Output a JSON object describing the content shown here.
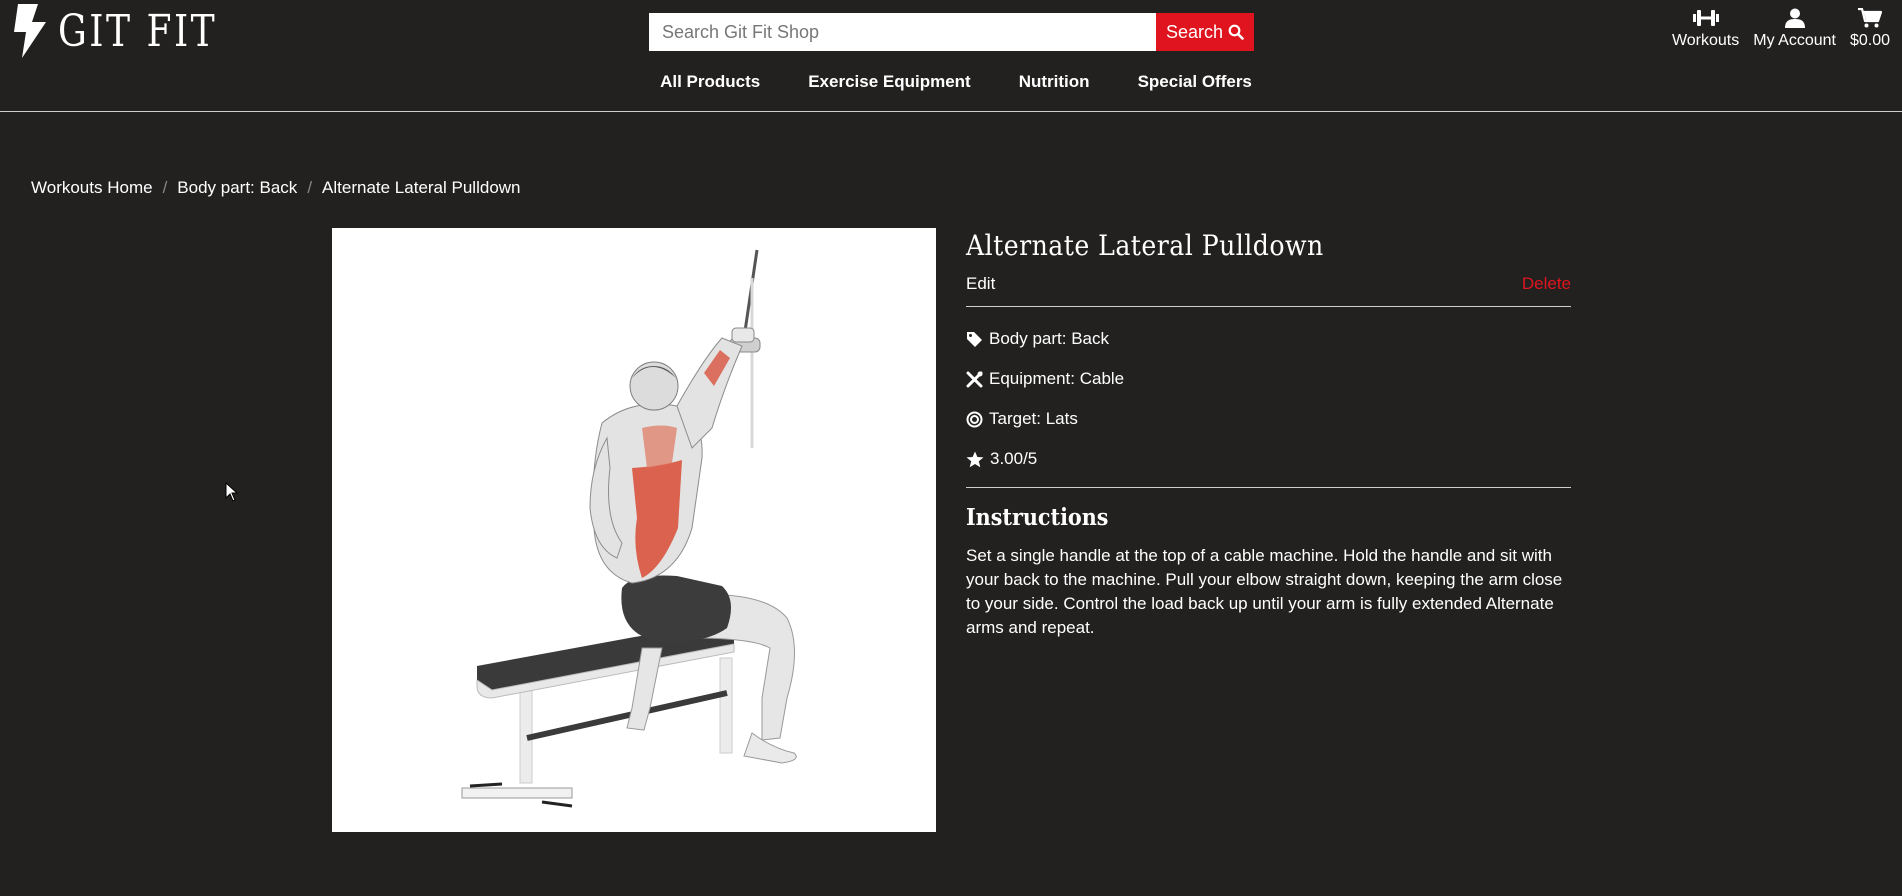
{
  "brand": {
    "name": "GIT FIT"
  },
  "search": {
    "placeholder": "Search Git Fit Shop",
    "button_label": "Search"
  },
  "account_nav": {
    "workouts_label": "Workouts",
    "account_label": "My Account",
    "cart_total": "$0.00"
  },
  "main_nav": {
    "items": [
      {
        "label": "All Products"
      },
      {
        "label": "Exercise Equipment"
      },
      {
        "label": "Nutrition"
      },
      {
        "label": "Special Offers"
      }
    ]
  },
  "breadcrumb": {
    "items": [
      {
        "label": "Workouts Home"
      },
      {
        "label": "Body part: Back"
      },
      {
        "label": "Alternate Lateral Pulldown"
      }
    ]
  },
  "exercise": {
    "title": "Alternate Lateral Pulldown",
    "edit_label": "Edit",
    "delete_label": "Delete",
    "body_part": "Body part: Back",
    "equipment": "Equipment: Cable",
    "target": "Target: Lats",
    "rating": "3.00/5",
    "instructions_heading": "Instructions",
    "instructions": "Set a single handle at the top of a cable machine. Hold the handle and sit with your back to the machine. Pull your elbow straight down, keeping the arm close to your side. Control the load back up until your arm is fully extended Alternate arms and repeat."
  },
  "colors": {
    "background": "#222120",
    "accent": "#e0141e",
    "text": "#ffffff"
  }
}
